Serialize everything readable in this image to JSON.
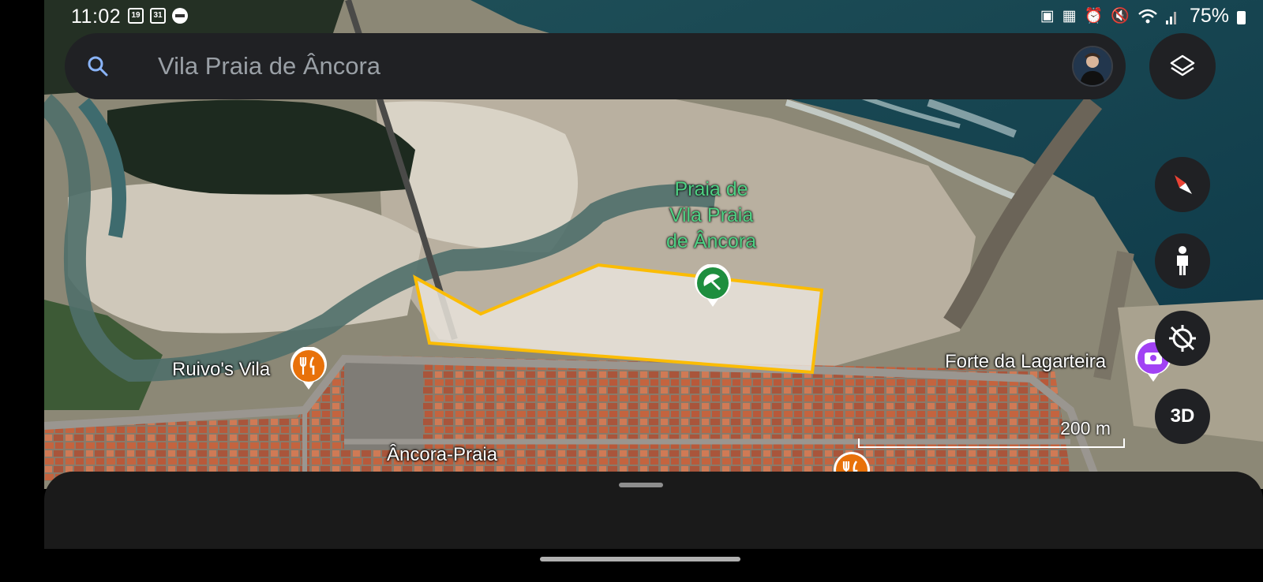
{
  "status_bar": {
    "time": "11:02",
    "left_icons": [
      "samsung-calendar-icon",
      "calendar-icon",
      "do-not-disturb-icon"
    ],
    "calendar_a": "19",
    "calendar_b": "31",
    "right_icons": [
      "battery-saver-icon",
      "building-icon",
      "alarm-icon",
      "mute-icon",
      "wifi-icon",
      "signal-icon"
    ],
    "battery": "75%"
  },
  "search": {
    "query": "Vila Praia de Âncora",
    "icon": "search-icon"
  },
  "controls": {
    "layers_icon": "layers-icon",
    "compass_icon": "compass-icon",
    "pegman_icon": "street-view-icon",
    "location_icon": "location-off-icon",
    "threed_label": "3D"
  },
  "map": {
    "type": "satellite",
    "beach_label_lines": [
      "Praia de",
      "Vila Praia",
      "de Âncora"
    ],
    "places": [
      {
        "name": "Ruivo's Vila",
        "category": "restaurant"
      },
      {
        "name": "Forte da Lagarteira",
        "category": "landmark"
      },
      {
        "name": "Âncora-Praia",
        "category": "area"
      }
    ],
    "scale_text": "200 m",
    "colors": {
      "highlight_outline": "#fbbc04",
      "beach_pin": "#1e8e3e",
      "restaurant_pin": "#e8710a",
      "landmark_pin": "#a142f4"
    }
  }
}
